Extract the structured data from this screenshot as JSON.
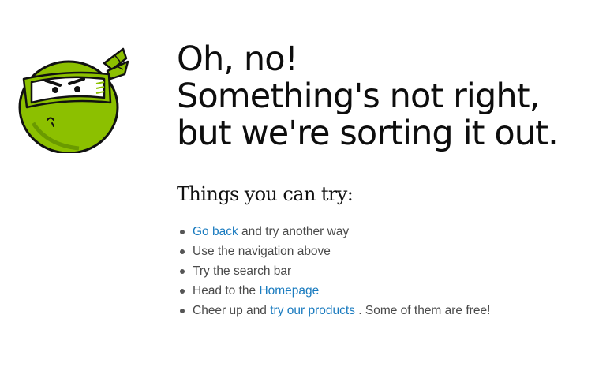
{
  "mascot": {
    "icon": "ninja-face-icon",
    "colors": {
      "skin": "#8cc000",
      "mask": "#ffffff",
      "outline": "#111111"
    }
  },
  "headline": {
    "line1": "Oh, no!",
    "line2": "Something's not right,",
    "line3": "but we're sorting it out."
  },
  "subheading": "Things you can try:",
  "tips": [
    {
      "link": "Go back",
      "after": " and try another way"
    },
    {
      "text": "Use the navigation above"
    },
    {
      "text": "Try the search bar"
    },
    {
      "before": "Head to the ",
      "link": "Homepage"
    },
    {
      "before": "Cheer up and ",
      "link": "try our products",
      "after": " . Some of them are free!"
    }
  ],
  "colors": {
    "link": "#1a7bbf",
    "body_text": "#4a4a4a",
    "heading": "#0d0d0d"
  }
}
